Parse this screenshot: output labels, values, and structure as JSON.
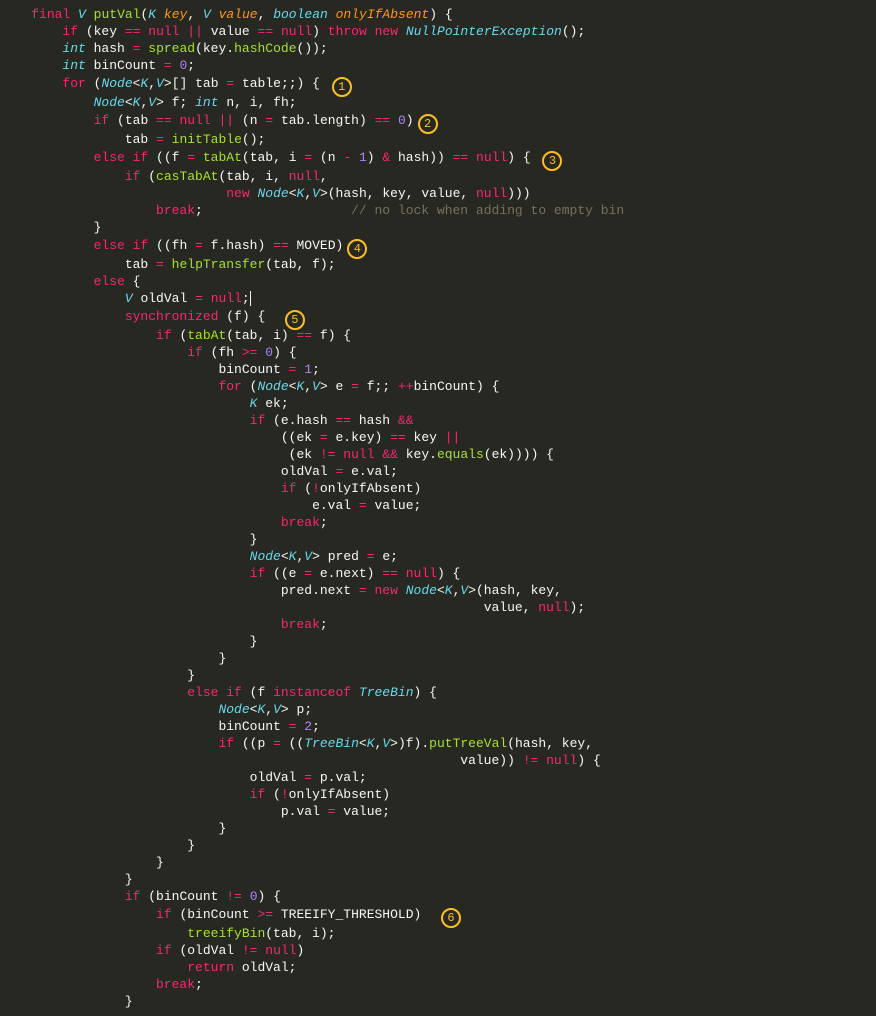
{
  "badges": {
    "b1": "1",
    "b2": "2",
    "b3": "3",
    "b4": "4",
    "b5": "5",
    "b6": "6"
  },
  "code": {
    "l1": {
      "a": "final",
      "b": "V",
      "c": "putVal",
      "d": "K",
      "e": "key",
      "f": "V",
      "g": "value",
      "h": "boolean",
      "i": "onlyIfAbsent",
      "j": ") {"
    },
    "l2": {
      "a": "if",
      "b": " (key ",
      "c": "==",
      "d": "null",
      "e": "||",
      "f": " value ",
      "g": "==",
      "h": "null",
      "i": ") ",
      "j": "throw",
      "k": "new",
      "l": "NullPointerException",
      "m": "();"
    },
    "l3": {
      "a": "int",
      "b": " hash ",
      "c": "=",
      "d": "spread",
      "e": "(key.",
      "f": "hashCode",
      "g": "());"
    },
    "l4": {
      "a": "int",
      "b": " binCount ",
      "c": "=",
      "d": "0",
      "e": ";"
    },
    "l5": {
      "a": "for",
      "b": " (",
      "c": "Node",
      "d": "<",
      "e": "K",
      "f": ",",
      "g": "V",
      "h": ">",
      "i": "[] tab ",
      "j": "=",
      "k": " table;;) {"
    },
    "l6": {
      "a": "Node",
      "b": "<",
      "c": "K",
      "d": ",",
      "e": "V",
      "f": ">",
      "g": " f; ",
      "h": "int",
      "i": " n, i, fh;"
    },
    "l7": {
      "a": "if",
      "b": " (tab ",
      "c": "==",
      "d": "null",
      "e": "||",
      "f": " (n ",
      "g": "=",
      "h": " tab.length) ",
      "i": "==",
      "j": "0",
      "k": ")"
    },
    "l8": {
      "a": "tab ",
      "b": "=",
      "c": "initTable",
      "d": "();"
    },
    "l9": {
      "a": "else if",
      "b": " ((f ",
      "c": "=",
      "d": "tabAt",
      "e": "(tab, i ",
      "f": "=",
      "g": " (n ",
      "h": "-",
      "i": "1",
      "j": ") ",
      "k": "&",
      "l": " hash)) ",
      "m": "==",
      "n": "null",
      "o": ") {"
    },
    "l10": {
      "a": "if",
      "b": " (",
      "c": "casTabAt",
      "d": "(tab, i, ",
      "e": "null",
      "f": ","
    },
    "l11": {
      "a": "new",
      "b": "Node",
      "c": "<",
      "d": "K",
      "e": ",",
      "f": "V",
      "g": ">",
      "h": "(hash, key, value, ",
      "i": "null",
      "j": ")))"
    },
    "l12": {
      "a": "break",
      "b": ";",
      "c": "// no lock when adding to empty bin"
    },
    "l13": {
      "a": "}"
    },
    "l14": {
      "a": "else if",
      "b": " ((fh ",
      "c": "=",
      "d": " f.hash) ",
      "e": "==",
      "f": " MOVED)"
    },
    "l15": {
      "a": "tab ",
      "b": "=",
      "c": "helpTransfer",
      "d": "(tab, f);"
    },
    "l16": {
      "a": "else",
      "b": " {"
    },
    "l17": {
      "a": "V",
      "b": " oldVal ",
      "c": "=",
      "d": "null",
      "e": ";"
    },
    "l18": {
      "a": "synchronized",
      "b": " (f) {"
    },
    "l19": {
      "a": "if",
      "b": " (",
      "c": "tabAt",
      "d": "(tab, i) ",
      "e": "==",
      "f": " f) {"
    },
    "l20": {
      "a": "if",
      "b": " (fh ",
      "c": ">=",
      "d": "0",
      "e": ") {"
    },
    "l21": {
      "a": "binCount ",
      "b": "=",
      "c": "1",
      "d": ";"
    },
    "l22": {
      "a": "for",
      "b": " (",
      "c": "Node",
      "d": "<",
      "e": "K",
      "f": ",",
      "g": "V",
      "h": ">",
      "i": " e ",
      "j": "=",
      "k": " f;; ",
      "l": "++",
      "m": "binCount) {"
    },
    "l23": {
      "a": "K",
      "b": " ek;"
    },
    "l24": {
      "a": "if",
      "b": " (e.hash ",
      "c": "==",
      "d": " hash ",
      "e": "&&"
    },
    "l25": {
      "a": "((ek ",
      "b": "=",
      "c": " e.key) ",
      "d": "==",
      "e": " key ",
      "f": "||"
    },
    "l26": {
      "a": " (ek ",
      "b": "!=",
      "c": "null",
      "d": "&&",
      "e": " key.",
      "f": "equals",
      "g": "(ek)))) {"
    },
    "l27": {
      "a": "oldVal ",
      "b": "=",
      "c": " e.val;"
    },
    "l28": {
      "a": "if",
      "b": " (",
      "c": "!",
      "d": "onlyIfAbsent)"
    },
    "l29": {
      "a": "e.val ",
      "b": "=",
      "c": " value;"
    },
    "l30": {
      "a": "break",
      "b": ";"
    },
    "l31": {
      "a": "}"
    },
    "l32": {
      "a": "Node",
      "b": "<",
      "c": "K",
      "d": ",",
      "e": "V",
      "f": ">",
      "g": " pred ",
      "h": "=",
      "i": " e;"
    },
    "l33": {
      "a": "if",
      "b": " ((e ",
      "c": "=",
      "d": " e.next) ",
      "e": "==",
      "f": "null",
      "g": ") {"
    },
    "l34": {
      "a": "pred.next ",
      "b": "=",
      "c": "new",
      "d": "Node",
      "e": "<",
      "f": "K",
      "g": ",",
      "h": "V",
      "i": ">",
      "j": "(hash, key,"
    },
    "l35": {
      "a": "value, ",
      "b": "null",
      "c": ");"
    },
    "l36": {
      "a": "break",
      "b": ";"
    },
    "l37": {
      "a": "}"
    },
    "l38": {
      "a": "}"
    },
    "l39": {
      "a": "}"
    },
    "l40": {
      "a": "else if",
      "b": " (f ",
      "c": "instanceof",
      "d": "TreeBin",
      "e": ") {"
    },
    "l41": {
      "a": "Node",
      "b": "<",
      "c": "K",
      "d": ",",
      "e": "V",
      "f": ">",
      "g": " p;"
    },
    "l42": {
      "a": "binCount ",
      "b": "=",
      "c": "2",
      "d": ";"
    },
    "l43": {
      "a": "if",
      "b": " ((p ",
      "c": "=",
      "d": " ((",
      "e": "TreeBin",
      "f": "<",
      "g": "K",
      "h": ",",
      "i": "V",
      "j": ">",
      "k": ")f).",
      "l": "putTreeVal",
      "m": "(hash, key,"
    },
    "l44": {
      "a": "value)) ",
      "b": "!=",
      "c": "null",
      "d": ") {"
    },
    "l45": {
      "a": "oldVal ",
      "b": "=",
      "c": " p.val;"
    },
    "l46": {
      "a": "if",
      "b": " (",
      "c": "!",
      "d": "onlyIfAbsent)"
    },
    "l47": {
      "a": "p.val ",
      "b": "=",
      "c": " value;"
    },
    "l48": {
      "a": "}"
    },
    "l49": {
      "a": "}"
    },
    "l50": {
      "a": "}"
    },
    "l51": {
      "a": "}"
    },
    "l52": {
      "a": "if",
      "b": " (binCount ",
      "c": "!=",
      "d": "0",
      "e": ") {"
    },
    "l53": {
      "a": "if",
      "b": " (binCount ",
      "c": ">=",
      "d": " TREEIFY_THRESHOLD)"
    },
    "l54": {
      "a": "treeifyBin",
      "b": "(tab, i);"
    },
    "l55": {
      "a": "if",
      "b": " (oldVal ",
      "c": "!=",
      "d": "null",
      "e": ")"
    },
    "l56": {
      "a": "return",
      "b": " oldVal;"
    },
    "l57": {
      "a": "break",
      "b": ";"
    },
    "l58": {
      "a": "}"
    }
  }
}
